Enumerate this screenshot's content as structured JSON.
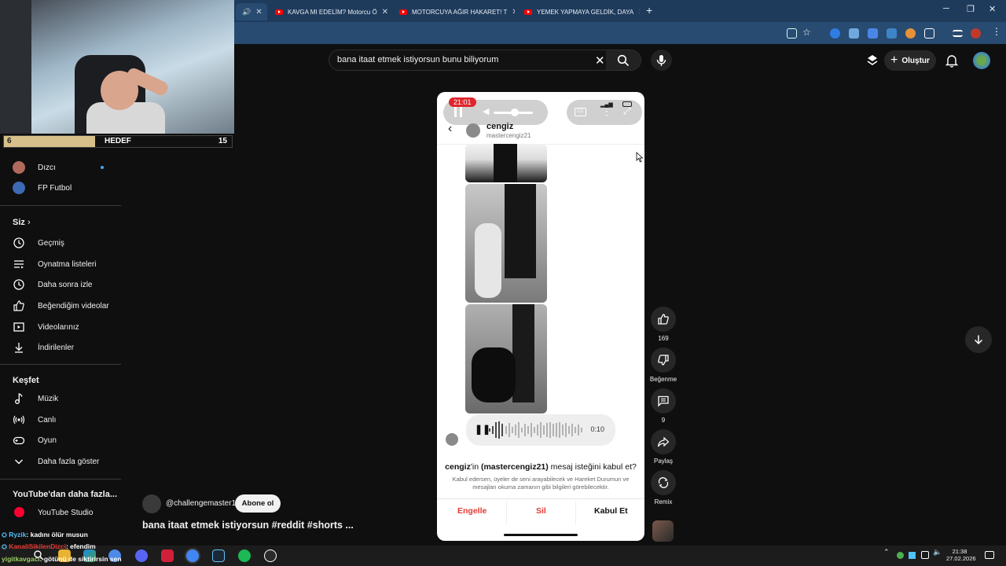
{
  "browser": {
    "tabs": [
      {
        "title": "KAVGA MI EDELİM? Motorcu Ö"
      },
      {
        "title": "MOTORCUYA AĞIR HAKARET! T"
      },
      {
        "title": "YEMEK YAPMAYA GELDİK, DAYA"
      }
    ]
  },
  "webcam_overlay": {
    "goal_current": "6",
    "goal_label": "HEDEF",
    "goal_target": "15",
    "goal_progress_fraction": 0.4
  },
  "header": {
    "search_query": "bana itaat etmek istiyorsun bunu biliyorum",
    "create_label": "Oluştur"
  },
  "sidebar": {
    "subscriptions": [
      {
        "label": "Dızcı"
      },
      {
        "label": "FP Futbol"
      }
    ],
    "you_heading": "Siz",
    "you_items": [
      {
        "label": "Geçmiş",
        "icon": "history-icon"
      },
      {
        "label": "Oynatma listeleri",
        "icon": "playlist-icon"
      },
      {
        "label": "Daha sonra izle",
        "icon": "clock-icon"
      },
      {
        "label": "Beğendiğim videolar",
        "icon": "thumbs-up-icon"
      },
      {
        "label": "Videolarınız",
        "icon": "video-icon"
      },
      {
        "label": "İndirilenler",
        "icon": "download-icon"
      }
    ],
    "explore_heading": "Keşfet",
    "explore_items": [
      {
        "label": "Müzik",
        "icon": "music-icon"
      },
      {
        "label": "Canlı",
        "icon": "live-icon"
      },
      {
        "label": "Oyun",
        "icon": "gamepad-icon"
      },
      {
        "label": "Daha fazla göster",
        "icon": "chevron-down-icon"
      }
    ],
    "more_heading": "YouTube'dan daha fazla...",
    "more_items": [
      {
        "label": "YouTube Studio"
      }
    ]
  },
  "short": {
    "status_time": "21:01",
    "chat_name": "cengiz",
    "chat_handle": "mastercengiz21",
    "voice_duration": "0:10",
    "request_name": "cengiz",
    "request_mid": "'in ",
    "request_handle": "(mastercengiz21)",
    "request_rest": " mesaj isteğini kabul et?",
    "request_subtitle": "Kabul edersen, üyeler de seni arayabilecek ve Hareket Durumun ve mesajları okuma zamanın gibi bilgileri görebilecektir.",
    "buttons": {
      "block": "Engelle",
      "delete": "Sil",
      "accept": "Kabul Et"
    }
  },
  "actions": {
    "like_count": "169",
    "dislike_label": "Beğenme",
    "comment_count": "9",
    "share_label": "Paylaş",
    "remix_label": "Remix"
  },
  "video": {
    "channel": "@challengemaster1",
    "subscribe_label": "Abone ol",
    "title": "bana itaat etmek istiyorsun  #reddit #shorts ..."
  },
  "stream_chat": [
    {
      "user": "Ryzik",
      "msg": ": kadını ölür musun",
      "color": "#4fc3f7"
    },
    {
      "user": "KanaliSikilenDizci",
      "msg": ": efendim",
      "color": "#e53935"
    },
    {
      "user": "yigitkavgaci",
      "msg": ": götünü de siktirirsin sen",
      "color": "#9ccc65"
    }
  ],
  "taskbar": {
    "time": "21:38",
    "date": "27.02.2026"
  }
}
